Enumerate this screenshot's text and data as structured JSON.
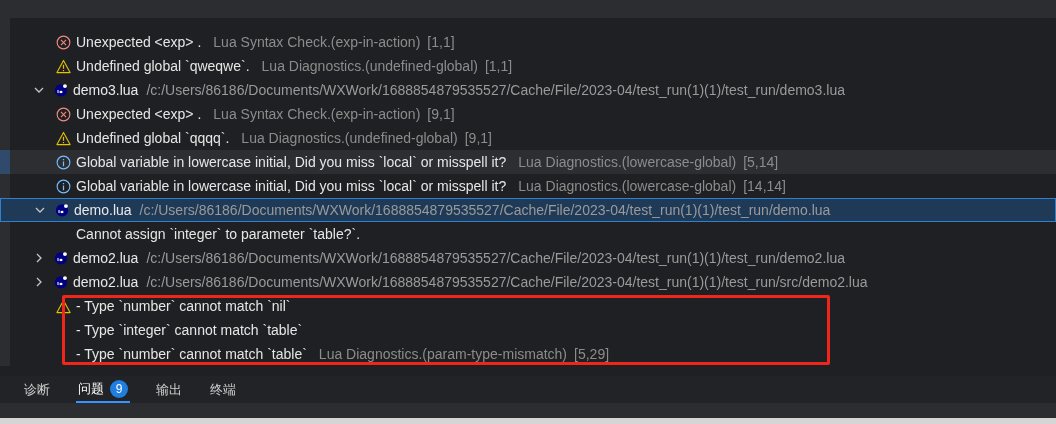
{
  "rows": [
    {
      "kind": "error",
      "message": "Unexpected <exp> .",
      "source": "Lua Syntax Check.(exp-in-action)",
      "location": "[1,1]",
      "selected": false
    },
    {
      "kind": "warning",
      "message": "Undefined global `qweqwe`.",
      "source": "Lua Diagnostics.(undefined-global)",
      "location": "[1,1]",
      "selected": false
    },
    {
      "kind": "file",
      "name": "demo3.lua",
      "path": "/c:/Users/86186/Documents/WXWork/1688854879535527/Cache/File/2023-04/test_run(1)(1)/test_run/demo3.lua",
      "expanded": true,
      "selected": false
    },
    {
      "kind": "error",
      "message": "Unexpected <exp> .",
      "source": "Lua Syntax Check.(exp-in-action)",
      "location": "[9,1]",
      "selected": false
    },
    {
      "kind": "warning",
      "message": "Undefined global `qqqq`.",
      "source": "Lua Diagnostics.(undefined-global)",
      "location": "[9,1]",
      "selected": false
    },
    {
      "kind": "info",
      "message": "Global variable in lowercase initial, Did you miss `local` or misspell it?",
      "source": "Lua Diagnostics.(lowercase-global)",
      "location": "[5,14]",
      "selected": true
    },
    {
      "kind": "info",
      "message": "Global variable in lowercase initial, Did you miss `local` or misspell it?",
      "source": "Lua Diagnostics.(lowercase-global)",
      "location": "[14,14]",
      "selected": false
    },
    {
      "kind": "file",
      "name": "demo.lua",
      "path": "/c:/Users/86186/Documents/WXWork/1688854879535527/Cache/File/2023-04/test_run(1)(1)/test_run/demo.lua",
      "expanded": true,
      "selected": true
    },
    {
      "kind": "text",
      "message": "Cannot assign `integer` to parameter `table?`."
    },
    {
      "kind": "file",
      "name": "demo2.lua",
      "path": "/c:/Users/86186/Documents/WXWork/1688854879535527/Cache/File/2023-04/test_run(1)(1)/test_run/demo2.lua",
      "expanded": false,
      "selected": false
    },
    {
      "kind": "file",
      "name": "demo2.lua",
      "path": "/c:/Users/86186/Documents/WXWork/1688854879535527/Cache/File/2023-04/test_run(1)(1)/test_run/src/demo2.lua",
      "expanded": false,
      "selected": false
    },
    {
      "kind": "warning",
      "message": "- Type `number` cannot match `nil`"
    },
    {
      "kind": "text",
      "message": "- Type `integer` cannot match `table`"
    },
    {
      "kind": "text",
      "message": "- Type `number` cannot match `table`",
      "source": "Lua Diagnostics.(param-type-mismatch)",
      "location": "[5,29]"
    }
  ],
  "tabs": [
    {
      "label": "诊断",
      "selected": false
    },
    {
      "label": "问题",
      "selected": true,
      "badge": "9"
    },
    {
      "label": "输出",
      "selected": false
    },
    {
      "label": "终端",
      "selected": false
    }
  ]
}
